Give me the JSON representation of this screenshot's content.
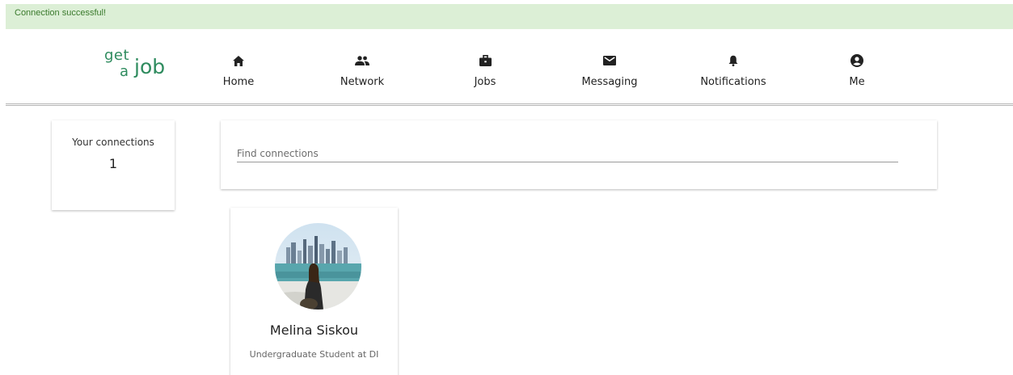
{
  "alert": {
    "message": "Connection successful!"
  },
  "logo": {
    "line1": "get",
    "line2": "a",
    "line3": "job"
  },
  "nav": [
    {
      "label": "Home",
      "icon": "home-icon"
    },
    {
      "label": "Network",
      "icon": "people-icon"
    },
    {
      "label": "Jobs",
      "icon": "briefcase-icon"
    },
    {
      "label": "Messaging",
      "icon": "envelope-icon"
    },
    {
      "label": "Notifications",
      "icon": "bell-icon"
    },
    {
      "label": "Me",
      "icon": "account-circle-icon"
    }
  ],
  "connections": {
    "title": "Your connections",
    "count": "1"
  },
  "search": {
    "placeholder": "Find connections",
    "value": ""
  },
  "profiles": [
    {
      "name": "Melina Siskou",
      "title": "Undergraduate Student at DI"
    }
  ],
  "colors": {
    "brand": "#2e8b5e",
    "alert_bg": "#dcefd6",
    "alert_text": "#3a7a2c"
  }
}
